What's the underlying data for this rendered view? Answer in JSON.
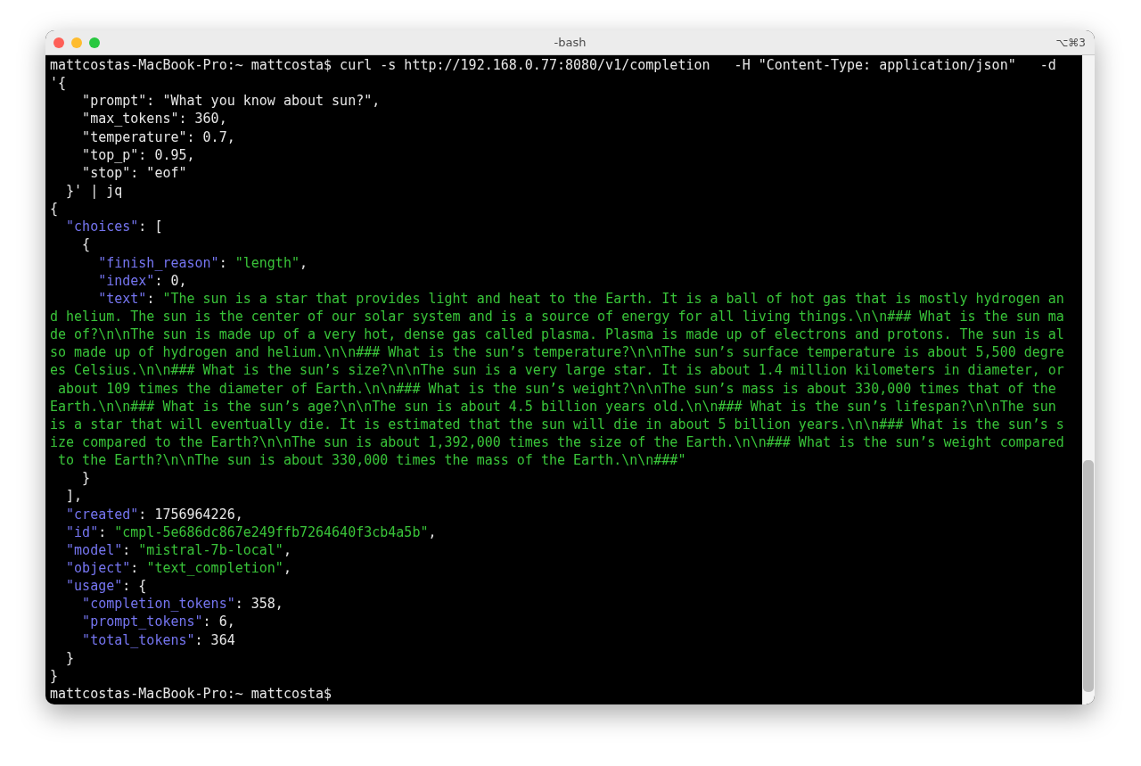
{
  "window": {
    "title": "-bash",
    "shortcut": "⌥⌘3"
  },
  "lines": [
    {
      "segments": [
        {
          "kind": "plain",
          "text": "mattcostas-MacBook-Pro:~ mattcosta$ curl -s http://192.168.0.77:8080/v1/completion   -H \"Content-Type: application/json\"   -d"
        }
      ]
    },
    {
      "segments": [
        {
          "kind": "plain",
          "text": "'{"
        }
      ]
    },
    {
      "segments": [
        {
          "kind": "plain",
          "text": "    \"prompt\": \"What you know about sun?\","
        }
      ]
    },
    {
      "segments": [
        {
          "kind": "plain",
          "text": "    \"max_tokens\": 360,"
        }
      ]
    },
    {
      "segments": [
        {
          "kind": "plain",
          "text": "    \"temperature\": 0.7,"
        }
      ]
    },
    {
      "segments": [
        {
          "kind": "plain",
          "text": "    \"top_p\": 0.95,"
        }
      ]
    },
    {
      "segments": [
        {
          "kind": "plain",
          "text": "    \"stop\": \"eof\""
        }
      ]
    },
    {
      "segments": [
        {
          "kind": "plain",
          "text": "  }' | jq"
        }
      ]
    },
    {
      "segments": [
        {
          "kind": "plain",
          "text": "{"
        }
      ]
    },
    {
      "segments": [
        {
          "kind": "key",
          "text": "  \"choices\""
        },
        {
          "kind": "plain",
          "text": ": ["
        }
      ]
    },
    {
      "segments": [
        {
          "kind": "plain",
          "text": "    {"
        }
      ]
    },
    {
      "segments": [
        {
          "kind": "key",
          "text": "      \"finish_reason\""
        },
        {
          "kind": "plain",
          "text": ": "
        },
        {
          "kind": "string",
          "text": "\"length\""
        },
        {
          "kind": "plain",
          "text": ","
        }
      ]
    },
    {
      "segments": [
        {
          "kind": "key",
          "text": "      \"index\""
        },
        {
          "kind": "plain",
          "text": ": 0,"
        }
      ]
    },
    {
      "segments": [
        {
          "kind": "key",
          "text": "      \"text\""
        },
        {
          "kind": "plain",
          "text": ": "
        },
        {
          "kind": "string",
          "text": "\"The sun is a star that provides light and heat to the Earth. It is a ball of hot gas that is mostly hydrogen an"
        }
      ]
    },
    {
      "segments": [
        {
          "kind": "string",
          "text": "d helium. The sun is the center of our solar system and is a source of energy for all living things.\\n\\n### What is the sun ma"
        }
      ]
    },
    {
      "segments": [
        {
          "kind": "string",
          "text": "de of?\\n\\nThe sun is made up of a very hot, dense gas called plasma. Plasma is made up of electrons and protons. The sun is al"
        }
      ]
    },
    {
      "segments": [
        {
          "kind": "string",
          "text": "so made up of hydrogen and helium.\\n\\n### What is the sun’s temperature?\\n\\nThe sun’s surface temperature is about 5,500 degre"
        }
      ]
    },
    {
      "segments": [
        {
          "kind": "string",
          "text": "es Celsius.\\n\\n### What is the sun’s size?\\n\\nThe sun is a very large star. It is about 1.4 million kilometers in diameter, or"
        }
      ]
    },
    {
      "segments": [
        {
          "kind": "string",
          "text": " about 109 times the diameter of Earth.\\n\\n### What is the sun’s weight?\\n\\nThe sun’s mass is about 330,000 times that of the"
        }
      ]
    },
    {
      "segments": [
        {
          "kind": "string",
          "text": "Earth.\\n\\n### What is the sun’s age?\\n\\nThe sun is about 4.5 billion years old.\\n\\n### What is the sun’s lifespan?\\n\\nThe sun"
        }
      ]
    },
    {
      "segments": [
        {
          "kind": "string",
          "text": "is a star that will eventually die. It is estimated that the sun will die in about 5 billion years.\\n\\n### What is the sun’s s"
        }
      ]
    },
    {
      "segments": [
        {
          "kind": "string",
          "text": "ize compared to the Earth?\\n\\nThe sun is about 1,392,000 times the size of the Earth.\\n\\n### What is the sun’s weight compared"
        }
      ]
    },
    {
      "segments": [
        {
          "kind": "string",
          "text": " to the Earth?\\n\\nThe sun is about 330,000 times the mass of the Earth.\\n\\n###\""
        }
      ]
    },
    {
      "segments": [
        {
          "kind": "plain",
          "text": "    }"
        }
      ]
    },
    {
      "segments": [
        {
          "kind": "plain",
          "text": "  ],"
        }
      ]
    },
    {
      "segments": [
        {
          "kind": "key",
          "text": "  \"created\""
        },
        {
          "kind": "plain",
          "text": ": 1756964226,"
        }
      ]
    },
    {
      "segments": [
        {
          "kind": "key",
          "text": "  \"id\""
        },
        {
          "kind": "plain",
          "text": ": "
        },
        {
          "kind": "string",
          "text": "\"cmpl-5e686dc867e249ffb7264640f3cb4a5b\""
        },
        {
          "kind": "plain",
          "text": ","
        }
      ]
    },
    {
      "segments": [
        {
          "kind": "key",
          "text": "  \"model\""
        },
        {
          "kind": "plain",
          "text": ": "
        },
        {
          "kind": "string",
          "text": "\"mistral-7b-local\""
        },
        {
          "kind": "plain",
          "text": ","
        }
      ]
    },
    {
      "segments": [
        {
          "kind": "key",
          "text": "  \"object\""
        },
        {
          "kind": "plain",
          "text": ": "
        },
        {
          "kind": "string",
          "text": "\"text_completion\""
        },
        {
          "kind": "plain",
          "text": ","
        }
      ]
    },
    {
      "segments": [
        {
          "kind": "key",
          "text": "  \"usage\""
        },
        {
          "kind": "plain",
          "text": ": {"
        }
      ]
    },
    {
      "segments": [
        {
          "kind": "key",
          "text": "    \"completion_tokens\""
        },
        {
          "kind": "plain",
          "text": ": 358,"
        }
      ]
    },
    {
      "segments": [
        {
          "kind": "key",
          "text": "    \"prompt_tokens\""
        },
        {
          "kind": "plain",
          "text": ": 6,"
        }
      ]
    },
    {
      "segments": [
        {
          "kind": "key",
          "text": "    \"total_tokens\""
        },
        {
          "kind": "plain",
          "text": ": 364"
        }
      ]
    },
    {
      "segments": [
        {
          "kind": "plain",
          "text": "  }"
        }
      ]
    },
    {
      "segments": [
        {
          "kind": "plain",
          "text": "}"
        }
      ]
    },
    {
      "segments": [
        {
          "kind": "plain",
          "text": "mattcostas-MacBook-Pro:~ mattcosta$"
        }
      ]
    }
  ]
}
